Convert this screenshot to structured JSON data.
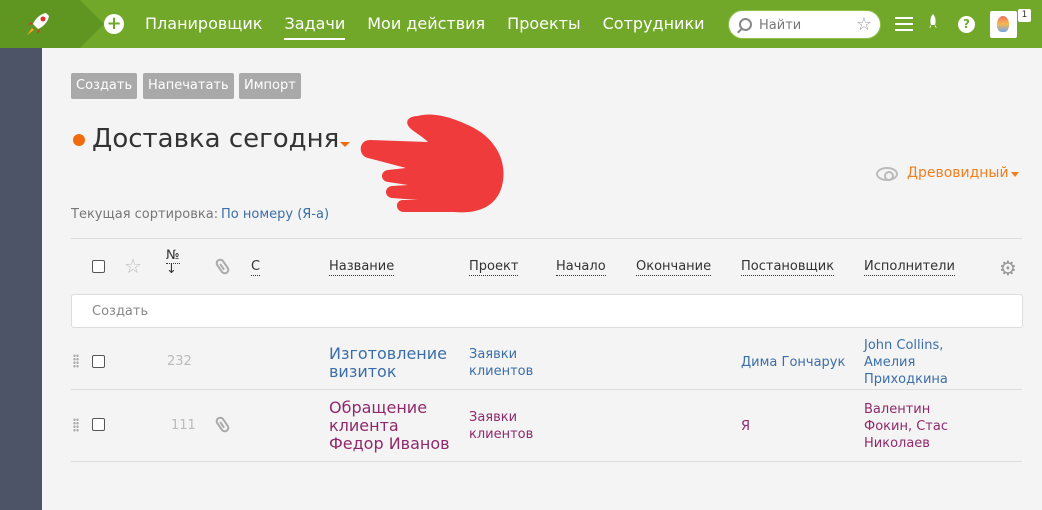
{
  "topbar": {
    "nav": [
      "Планировщик",
      "Задачи",
      "Мои действия",
      "Проекты",
      "Сотрудники"
    ],
    "active_index": 1,
    "search_placeholder": "Найти",
    "avatar_badge": "1",
    "brand_color": "#72a82a"
  },
  "toolbar": {
    "create": "Создать",
    "print": "Напечатать",
    "import": "Импорт"
  },
  "page": {
    "title": "Доставка сегодня",
    "view_mode": "Древовидный",
    "sort_label": "Текущая сортировка:",
    "sort_value": "По номеру (Я-а)"
  },
  "table": {
    "headers": {
      "num": "№",
      "num_arrow": "↓",
      "c": "С",
      "name": "Название",
      "project": "Проект",
      "start": "Начало",
      "end": "Окончание",
      "author": "Постановщик",
      "assignees": "Исполнители"
    },
    "create_placeholder": "Создать",
    "rows": [
      {
        "num": "232",
        "name": "Изготовление визиток",
        "project": "Заявки клиентов",
        "author": "Дима Гончарук",
        "assignees": "John Collins, Амелия Приходкина",
        "has_attachment": false
      },
      {
        "num": "111",
        "name": "Обращение клиента Федор Иванов",
        "project": "Заявки клиентов",
        "author": "Я",
        "assignees": "Валентин Фокин, Стас Николаев",
        "has_attachment": true
      }
    ]
  }
}
